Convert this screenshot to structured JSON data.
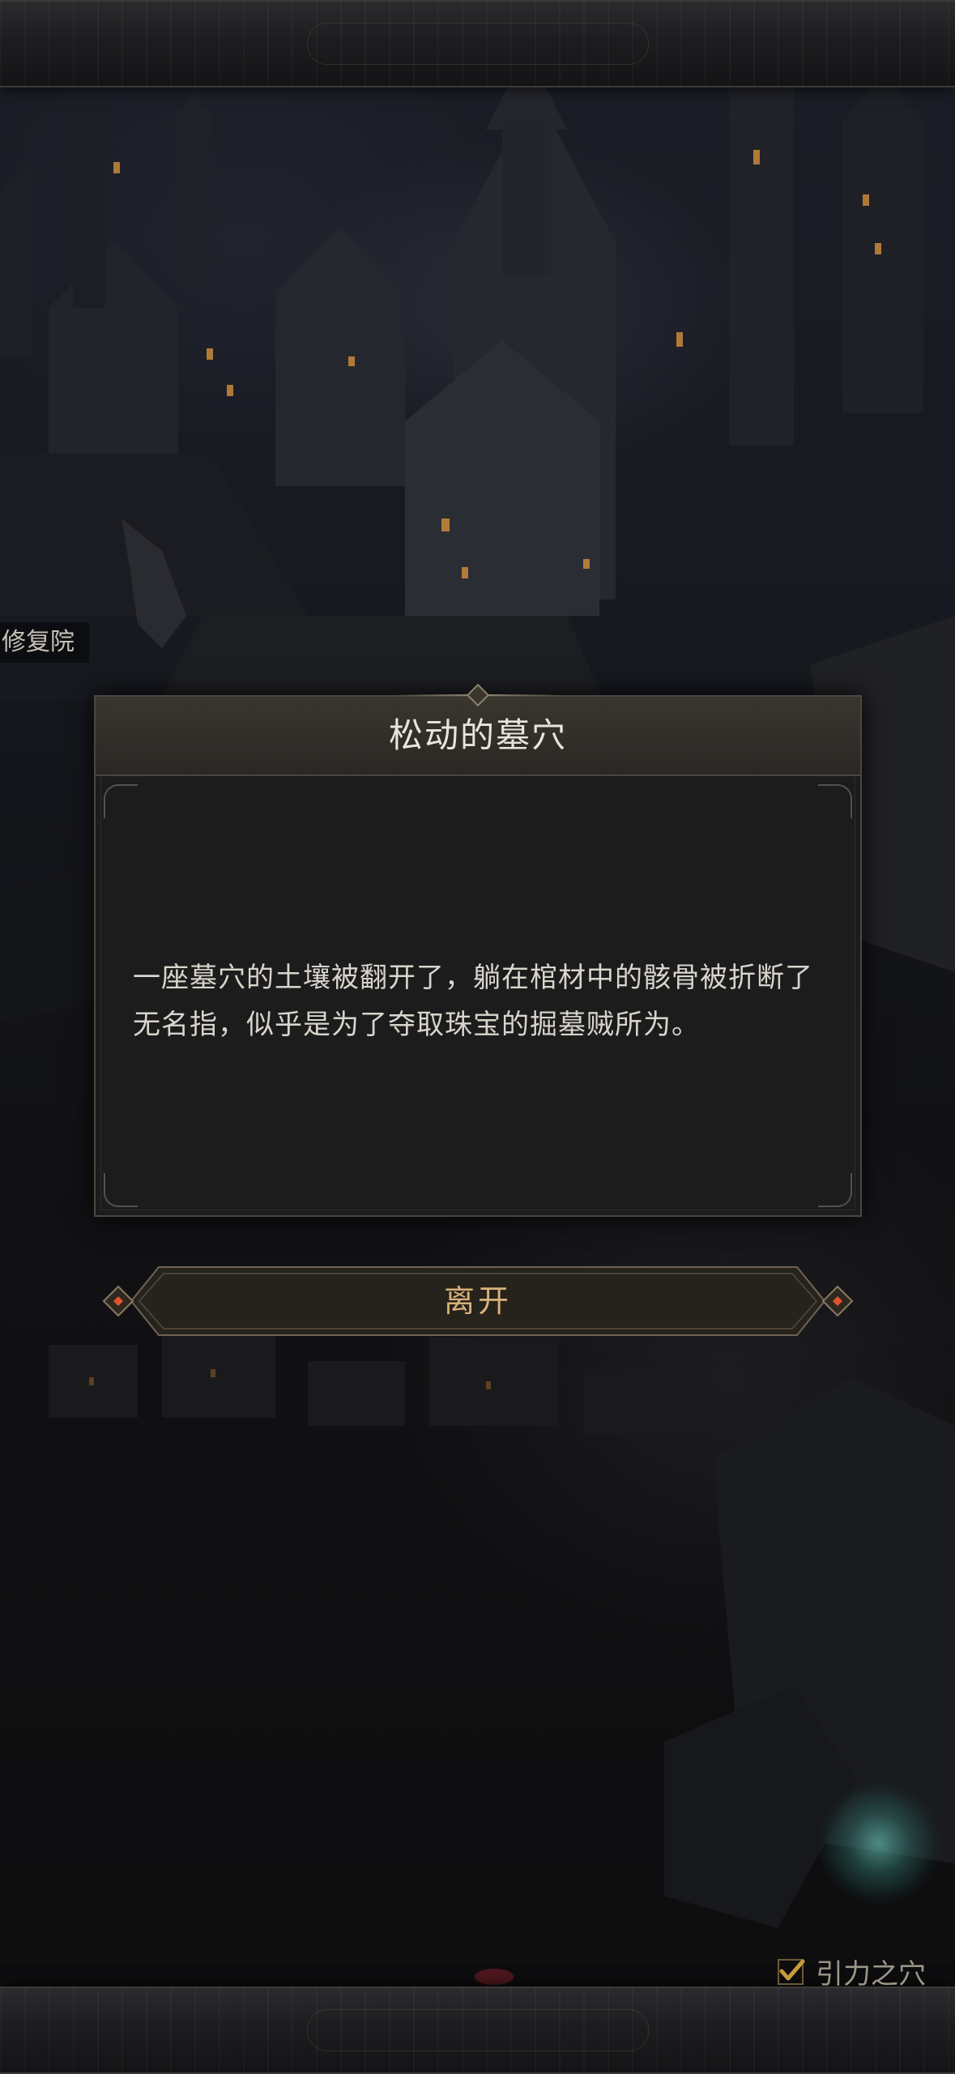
{
  "location": {
    "label": "修复院"
  },
  "event_dialog": {
    "title": "松动的墓穴",
    "body": "一座墓穴的土壤被翻开了，躺在棺材中的骸骨被折断了无名指，似乎是为了夺取珠宝的掘墓贼所为。"
  },
  "actions": {
    "leave_label": "离开"
  },
  "tracked_quest": {
    "label": "引力之穴",
    "icon": "check-icon"
  },
  "colors": {
    "title_text": "#e8e4dc",
    "body_text": "#d9d5cc",
    "button_text": "#d8b27a",
    "button_gem": "#e0542a"
  }
}
